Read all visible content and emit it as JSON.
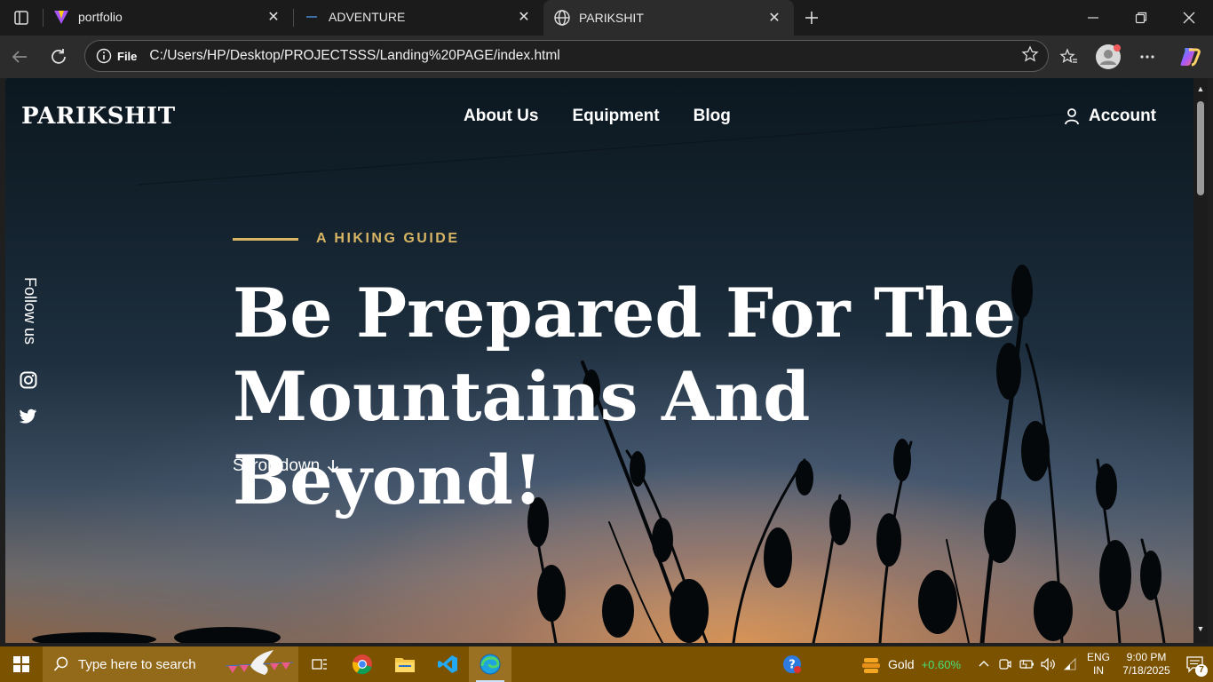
{
  "browser": {
    "tabs": [
      {
        "title": "portfolio",
        "icon": "vite-icon",
        "active": false
      },
      {
        "title": "ADVENTURE",
        "icon": "page-icon",
        "active": false
      },
      {
        "title": "PARIKSHIT",
        "icon": "globe-icon",
        "active": true
      }
    ],
    "address": {
      "scheme_label": "File",
      "url": "C:/Users/HP/Desktop/PROJECTSSS/Landing%20PAGE/index.html"
    }
  },
  "page": {
    "logo": "PARIKSHIT",
    "nav": [
      "About Us",
      "Equipment",
      "Blog"
    ],
    "account_label": "Account",
    "follow_label": "Follow us",
    "eyebrow": "A HIKING GUIDE",
    "headline_line1": "Be Prepared For The",
    "headline_line2": "Mountains And Beyond!",
    "scroll_label": "Scroll down",
    "colors": {
      "accent": "#d8b565",
      "text": "#ffffff"
    }
  },
  "taskbar": {
    "search_placeholder": "Type here to search",
    "apps": [
      "task-view-icon",
      "chrome-icon",
      "file-explorer-icon",
      "vscode-icon",
      "edge-icon"
    ],
    "widget_label": "Gold",
    "widget_change": "+0.60%",
    "lang_line1": "ENG",
    "lang_line2": "IN",
    "time": "9:00 PM",
    "date": "7/18/2025",
    "notification_count": "7"
  }
}
